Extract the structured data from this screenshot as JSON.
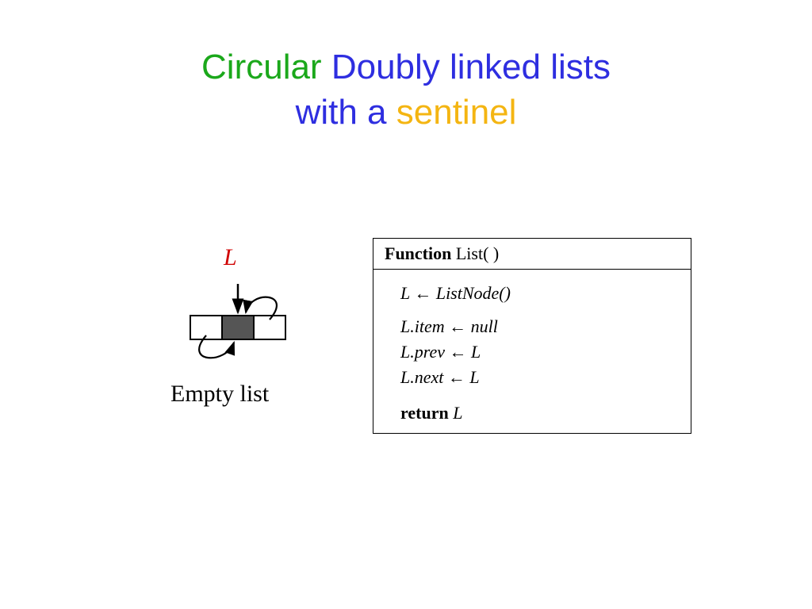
{
  "title": {
    "part1": "Circular",
    "part2": "Doubly linked lists",
    "part3": "with a",
    "part4": "sentinel"
  },
  "diagram": {
    "pointer_label": "L",
    "caption": "Empty list"
  },
  "code": {
    "func_kw": "Function",
    "func_name": "List( )",
    "line1": "L ← ListNode()",
    "line2": "L.item ← null",
    "line3": "L.prev ← L",
    "line4": "L.next ← L",
    "return_kw": "return",
    "return_val": "L"
  }
}
